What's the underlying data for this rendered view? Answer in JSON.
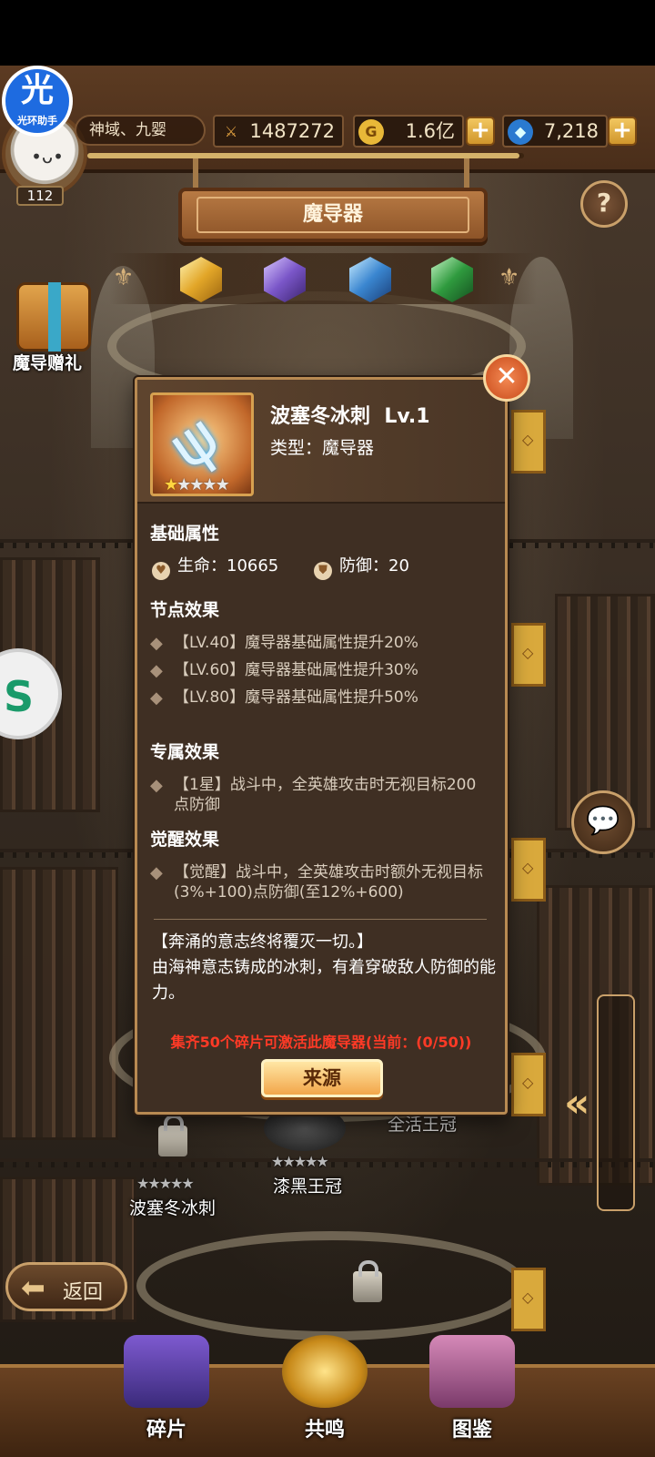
{
  "helper": {
    "big": "光",
    "small": "光环助手"
  },
  "player": {
    "level": "112",
    "server": "神域、九婴"
  },
  "resources": {
    "power": "1487272",
    "gold": "1.6亿",
    "gems": "7,218",
    "progress": 0.99
  },
  "page": {
    "title": "魔导器",
    "help_label": "?"
  },
  "tabs": [
    {
      "name": "gold-gem",
      "color": "#e2a628",
      "selected": true
    },
    {
      "name": "purple-gem",
      "color": "#7a56c8",
      "selected": false
    },
    {
      "name": "blue-gem",
      "color": "#3a86d0",
      "selected": false
    },
    {
      "name": "green-gem",
      "color": "#2f9a3e",
      "selected": false
    }
  ],
  "side": {
    "gift_label": "魔导赠礼"
  },
  "background_items": {
    "item1_label": "波塞冬冰刺",
    "item2_label": "漆黑王冠",
    "item3_label": "全活王冠"
  },
  "modal": {
    "item_name": "波塞冬冰刺",
    "item_level": "Lv.1",
    "item_type": "类型：魔导器",
    "stars_filled": 1,
    "stars_total": 5,
    "sections": {
      "base": "基础属性",
      "node": "节点效果",
      "exclusive": "专属效果",
      "awaken": "觉醒效果"
    },
    "stats": {
      "hp": "生命：10665",
      "def": "防御：20"
    },
    "node_effects": [
      "【LV.40】魔导器基础属性提升20%",
      "【LV.60】魔导器基础属性提升30%",
      "【LV.80】魔导器基础属性提升50%"
    ],
    "exclusive_effect": "【1星】战斗中，全英雄攻击时无视目标200点防御",
    "awaken_effect": "【觉醒】战斗中，全英雄攻击时额外无视目标(3%+100)点防御(至12%+600)",
    "lore_title": "【奔涌的意志终将覆灭一切。】",
    "lore_body": "由海神意志铸成的冰刺，有着穿破敌人防御的能力。",
    "collect_hint": "集齐50个碎片可激活此魔导器(当前：(0/50))",
    "source_button": "来源",
    "close_label": "✕"
  },
  "back_button": "返回",
  "bottom_nav": [
    {
      "label": "碎片",
      "active": false
    },
    {
      "label": "共鸣",
      "active": true
    },
    {
      "label": "图鉴",
      "active": false
    }
  ],
  "colors": {
    "accent": "#d7a150",
    "alert": "#ff3a26",
    "panel": "#3f2f23"
  }
}
